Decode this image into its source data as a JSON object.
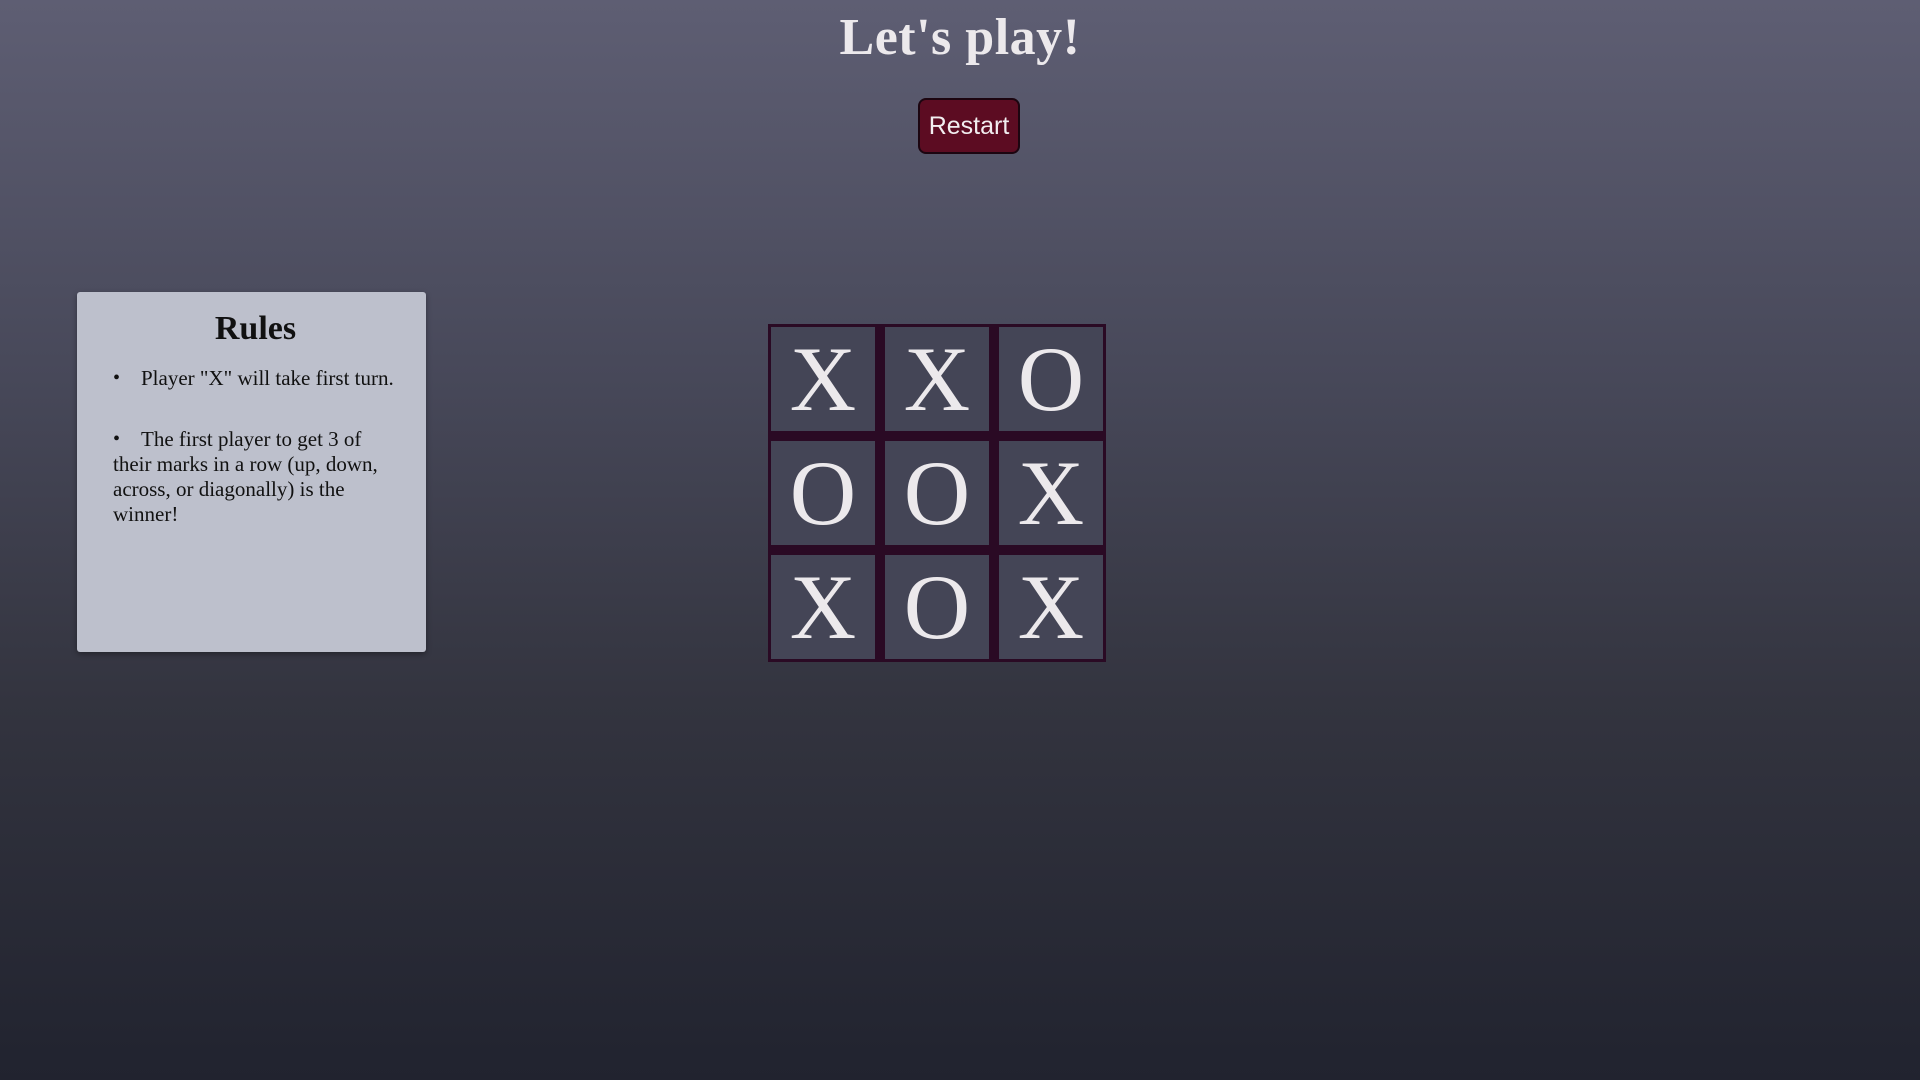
{
  "header": {
    "title": "Let's play!",
    "restart_label": "Restart"
  },
  "rules": {
    "heading": "Rules",
    "items": [
      "Player \"X\" will take first turn.",
      "The first player to get 3 of their marks in a row (up, down, across, or diagonally) is the winner!"
    ]
  },
  "board": {
    "cells": [
      "X",
      "X",
      "O",
      "O",
      "O",
      "X",
      "X",
      "O",
      "X"
    ]
  },
  "colors": {
    "button": "#5c0c22",
    "board_border": "#2a0a24",
    "cell": "#444556",
    "panel": "#bdc0cc",
    "text_light": "#ece9ec"
  }
}
